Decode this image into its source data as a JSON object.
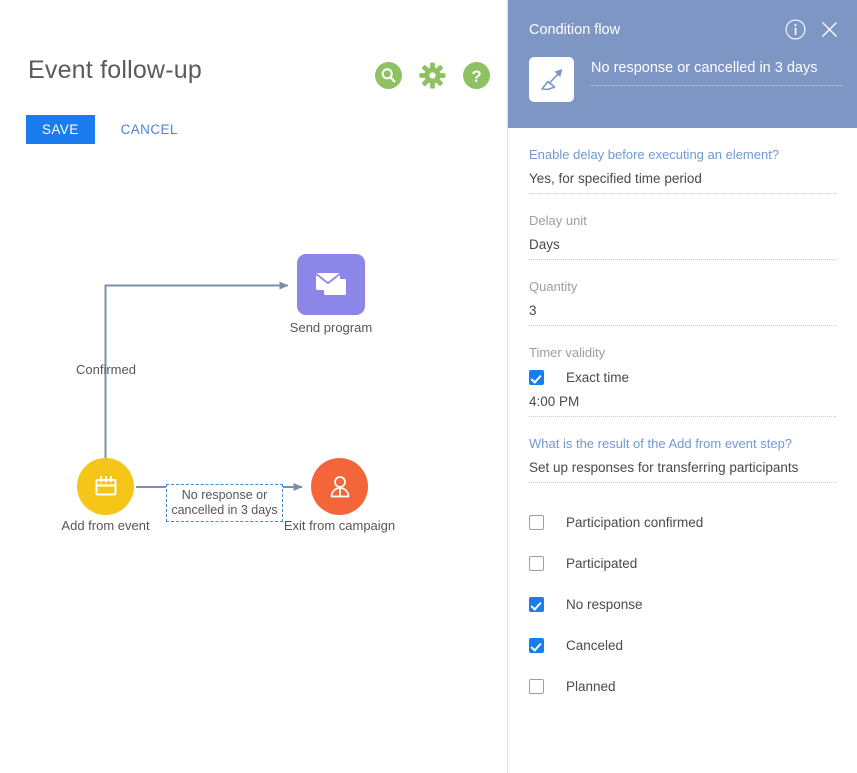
{
  "page": {
    "title": "Event follow-up"
  },
  "toolbar": {
    "icons": [
      {
        "name": "search-icon",
        "title": "Search"
      },
      {
        "name": "gear-icon",
        "title": "Settings"
      },
      {
        "name": "help-icon",
        "title": "Help"
      }
    ],
    "save_label": "SAVE",
    "cancel_label": "CANCEL",
    "accent_green": "#8ec161",
    "accent_blue": "#1b7ced"
  },
  "diagram": {
    "nodes": [
      {
        "id": "send-program",
        "label": "Send program",
        "icon": "envelope-icon",
        "color": "#8b86e8",
        "shape": "rounded-square"
      },
      {
        "id": "add-from-event",
        "label": "Add from event",
        "icon": "calendar-icon",
        "color": "#f5c518",
        "shape": "circle"
      },
      {
        "id": "exit-from-campaign",
        "label": "Exit from campaign",
        "icon": "person-icon",
        "color": "#f4663a",
        "shape": "circle"
      }
    ],
    "edges": [
      {
        "id": "confirmed",
        "label": "Confirmed",
        "from": "add-from-event",
        "to": "send-program"
      },
      {
        "id": "condition",
        "label_line1": "No response or",
        "label_line2": "cancelled in 3 days",
        "from": "add-from-event",
        "to": "exit-from-campaign",
        "selected": true
      }
    ],
    "connector_color": "#7a8fa8"
  },
  "panel": {
    "title": "Condition flow",
    "header_color": "#7d96c4",
    "info_icon": "info-icon",
    "close_icon": "close-icon",
    "flow_icon": "arrow-diagonal-icon",
    "flow_name": "No response or cancelled in 3 days",
    "fields": [
      {
        "name": "enable-delay",
        "label": "Enable delay before executing an element?",
        "label_style": "link",
        "value": "Yes, for specified time period"
      },
      {
        "name": "delay-unit",
        "label": "Delay unit",
        "label_style": "muted",
        "value": "Days"
      },
      {
        "name": "quantity",
        "label": "Quantity",
        "label_style": "muted",
        "value": "3"
      }
    ],
    "timer_validity": {
      "label": "Timer validity",
      "exact_time_label": "Exact time",
      "exact_time_checked": true,
      "time_value": "4:00 PM"
    },
    "result_section": {
      "label": "What is the result of the Add from event step?",
      "value": "Set up responses for transferring participants",
      "options": [
        {
          "name": "participation-confirmed",
          "label": "Participation confirmed",
          "checked": false
        },
        {
          "name": "participated",
          "label": "Participated",
          "checked": false
        },
        {
          "name": "no-response",
          "label": "No response",
          "checked": true
        },
        {
          "name": "canceled",
          "label": "Canceled",
          "checked": true
        },
        {
          "name": "planned",
          "label": "Planned",
          "checked": false
        }
      ]
    }
  }
}
